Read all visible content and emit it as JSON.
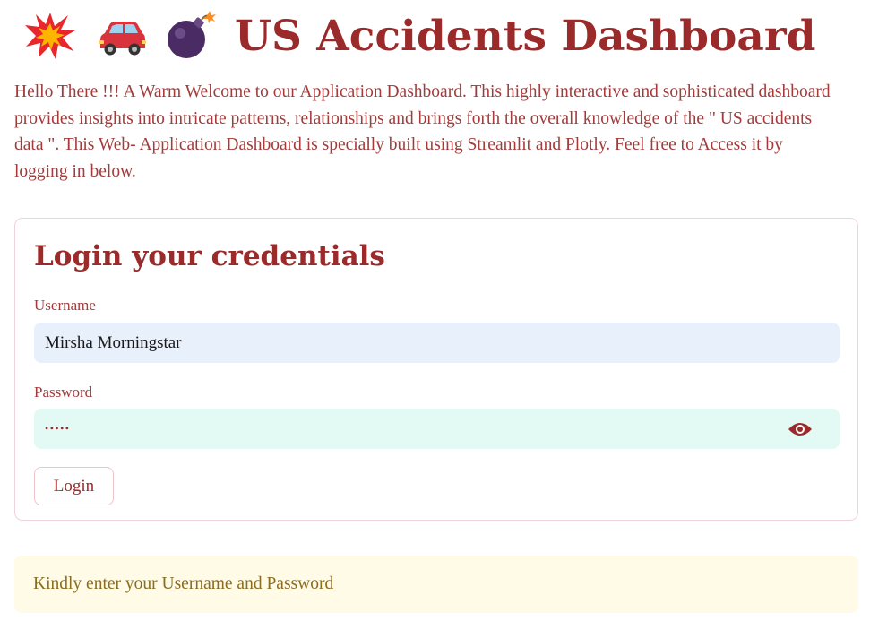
{
  "header": {
    "icons": [
      "collision-icon",
      "red-car-icon",
      "bomb-icon"
    ],
    "title": "US Accidents Dashboard"
  },
  "intro": {
    "text": "Hello There !!! A Warm Welcome to our Application Dashboard. This highly interactive and sophisticated dashboard provides insights into intricate patterns, relationships and brings forth the overall knowledge of the \" US accidents data \". This Web- Application Dashboard is specially built using Streamlit and Plotly. Feel free to Access it by logging in below."
  },
  "login_form": {
    "title": "Login your credentials",
    "username_label": "Username",
    "username_value": "Mirsha Morningstar",
    "password_label": "Password",
    "password_masked": "•••••",
    "password_toggle_icon": "eye-icon",
    "button_label": "Login"
  },
  "alert": {
    "message": "Kindly enter your Username and Password"
  },
  "colors": {
    "primary": "#9b2a2a",
    "text": "#a33b3b",
    "username_bg": "#e8f0fb",
    "password_bg": "#e2faf3",
    "alert_bg": "#fffbe6",
    "alert_text": "#8a6d1f",
    "card_border": "#f0d3d8"
  }
}
